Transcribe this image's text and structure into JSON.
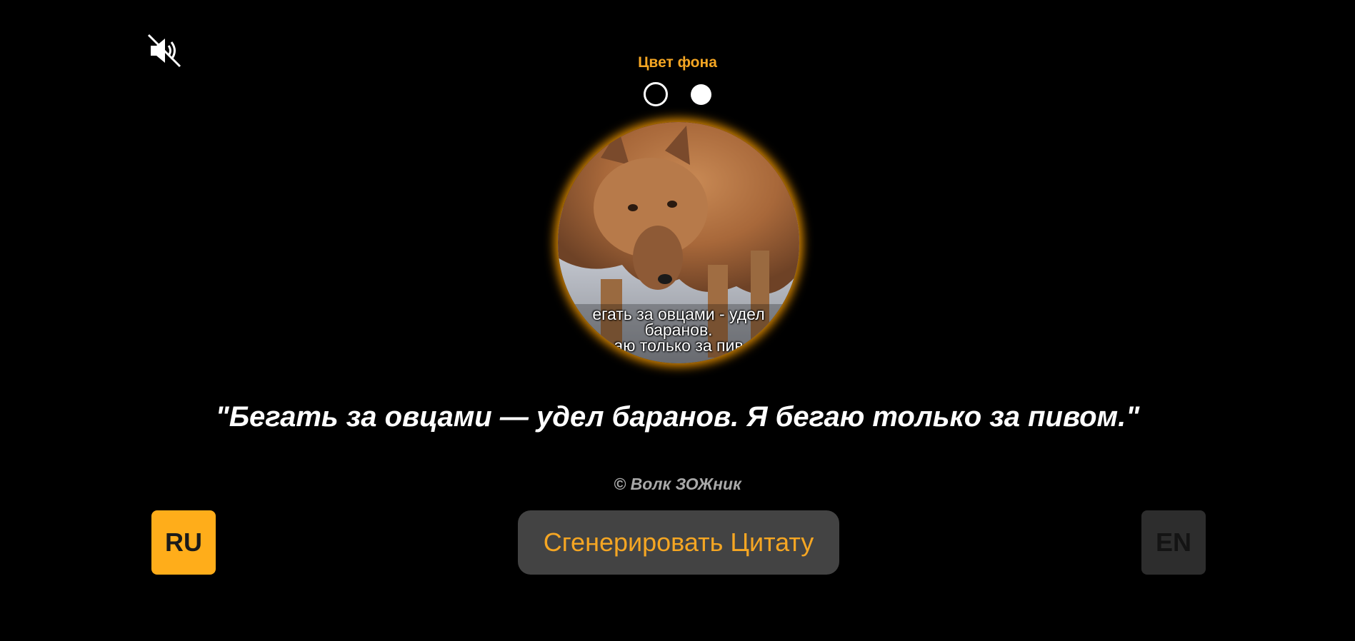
{
  "sound": {
    "icon": "speaker-muted-icon",
    "state": "muted"
  },
  "background": {
    "label": "Цвет фона",
    "options": [
      {
        "name": "black",
        "color": "#000000",
        "selected": true
      },
      {
        "name": "white",
        "color": "#ffffff",
        "selected": false
      }
    ]
  },
  "avatar": {
    "caption_lines": [
      "егать за овцами - удел",
      "баранов.",
      "аю только за пив"
    ]
  },
  "quote": {
    "text": "\"Бегать за овцами — удел баранов. Я бегаю только за пивом.\"",
    "author": "© Волк ЗОЖник"
  },
  "actions": {
    "lang_ru": "RU",
    "generate": "Сгенерировать Цитату",
    "lang_en": "EN"
  },
  "colors": {
    "accent": "#f5a623",
    "active_lang": "#ffad1a",
    "inactive_lang": "#2d2d2d",
    "button_bg": "#434343"
  }
}
